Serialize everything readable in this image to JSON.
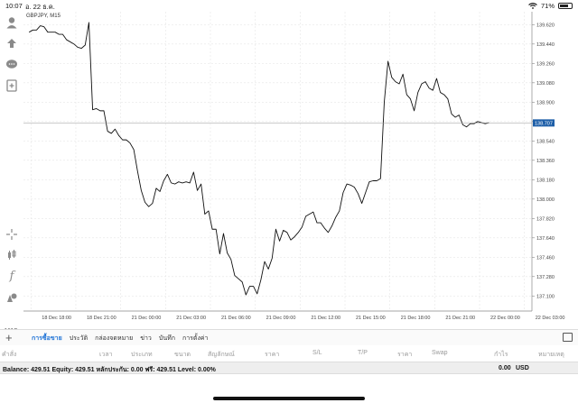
{
  "status_bar": {
    "time": "10:07",
    "date": "อ. 22 ธ.ค.",
    "battery": "71%",
    "battery_level": 0.71
  },
  "toolbar": {
    "tools": [
      "account-icon",
      "trade-icon",
      "chat-icon",
      "add-chart-icon",
      "crosshair-icon",
      "candles-icon",
      "indicator-icon",
      "objects-icon"
    ],
    "timeframe": "M15"
  },
  "chart": {
    "symbol": "GBPJPY, M15",
    "current_price": "138.707",
    "colors": {
      "line": "#111111",
      "grid": "#e6e6e6",
      "price_tag": "#1e5fa8",
      "price_line": "#9a9a9a"
    }
  },
  "chart_data": {
    "type": "line",
    "ylim": [
      136.96,
      139.74
    ],
    "y_ticks": [
      "139.620",
      "139.440",
      "139.260",
      "139.080",
      "138.900",
      "138.720",
      "138.540",
      "138.360",
      "138.180",
      "138.000",
      "137.820",
      "137.640",
      "137.460",
      "137.280",
      "137.100"
    ],
    "x_ticks": [
      "18 Dec 18:00",
      "18 Dec 21:00",
      "21 Dec 00:00",
      "21 Dec 03:00",
      "21 Dec 06:00",
      "21 Dec 09:00",
      "21 Dec 12:00",
      "21 Dec 15:00",
      "21 Dec 18:00",
      "21 Dec 21:00",
      "22 Dec 00:00",
      "22 Dec 03:00"
    ],
    "x_tick_positions": [
      0.5,
      12.5,
      24.5,
      36.5,
      48.5,
      60.5,
      72.5,
      84.5,
      96.5,
      108.5,
      120.5,
      132.5
    ],
    "xlim": [
      -1.5,
      134.5
    ],
    "series": [
      {
        "values": [
          139.55,
          139.57,
          139.57,
          139.61,
          139.6,
          139.55,
          139.55,
          139.55,
          139.53,
          139.53,
          139.48,
          139.46,
          139.44,
          139.41,
          139.4,
          139.43,
          139.64,
          138.83,
          138.84,
          138.82,
          138.82,
          138.63,
          138.61,
          138.65,
          138.59,
          138.55,
          138.55,
          138.52,
          138.46,
          138.26,
          138.08,
          137.97,
          137.93,
          137.96,
          138.1,
          138.07,
          138.17,
          138.23,
          138.15,
          138.14,
          138.16,
          138.15,
          138.16,
          138.15,
          138.25,
          138.08,
          138.14,
          137.86,
          137.89,
          137.72,
          137.72,
          137.49,
          137.68,
          137.5,
          137.44,
          137.29,
          137.26,
          137.23,
          137.11,
          137.19,
          137.19,
          137.12,
          137.25,
          137.42,
          137.35,
          137.45,
          137.72,
          137.61,
          137.71,
          137.69,
          137.62,
          137.65,
          137.69,
          137.74,
          137.84,
          137.86,
          137.88,
          137.78,
          137.78,
          137.73,
          137.69,
          137.75,
          137.83,
          137.89,
          138.06,
          138.14,
          138.13,
          138.11,
          138.05,
          137.96,
          138.06,
          138.16,
          138.17,
          138.17,
          138.19,
          138.9,
          139.28,
          139.13,
          139.09,
          139.07,
          139.16,
          138.97,
          138.93,
          138.82,
          138.99,
          139.07,
          139.09,
          139.03,
          139.01,
          139.12,
          138.99,
          138.97,
          138.93,
          138.79,
          138.76,
          138.78,
          138.69,
          138.67,
          138.7,
          138.7,
          138.72,
          138.71,
          138.7,
          138.71
        ]
      }
    ]
  },
  "tabs": [
    "การซื้อขาย",
    "ประวัติ",
    "กล่องจดหมาย",
    "ข่าว",
    "บันทึก",
    "การตั้งค่า"
  ],
  "columns": [
    "คำสั่ง",
    "เวลา",
    "ประเภท",
    "ขนาด",
    "สัญลักษณ์",
    "ราคา",
    "S/L",
    "T/P",
    "ราคา",
    "Swap",
    "กำไร",
    "หมายเหตุ"
  ],
  "balance": {
    "summary": "Balance: 429.51 Equity: 429.51 หลักประกัน: 0.00 ฟรี: 429.51 Level: 0.00%",
    "profit": "0.00",
    "currency": "USD"
  }
}
